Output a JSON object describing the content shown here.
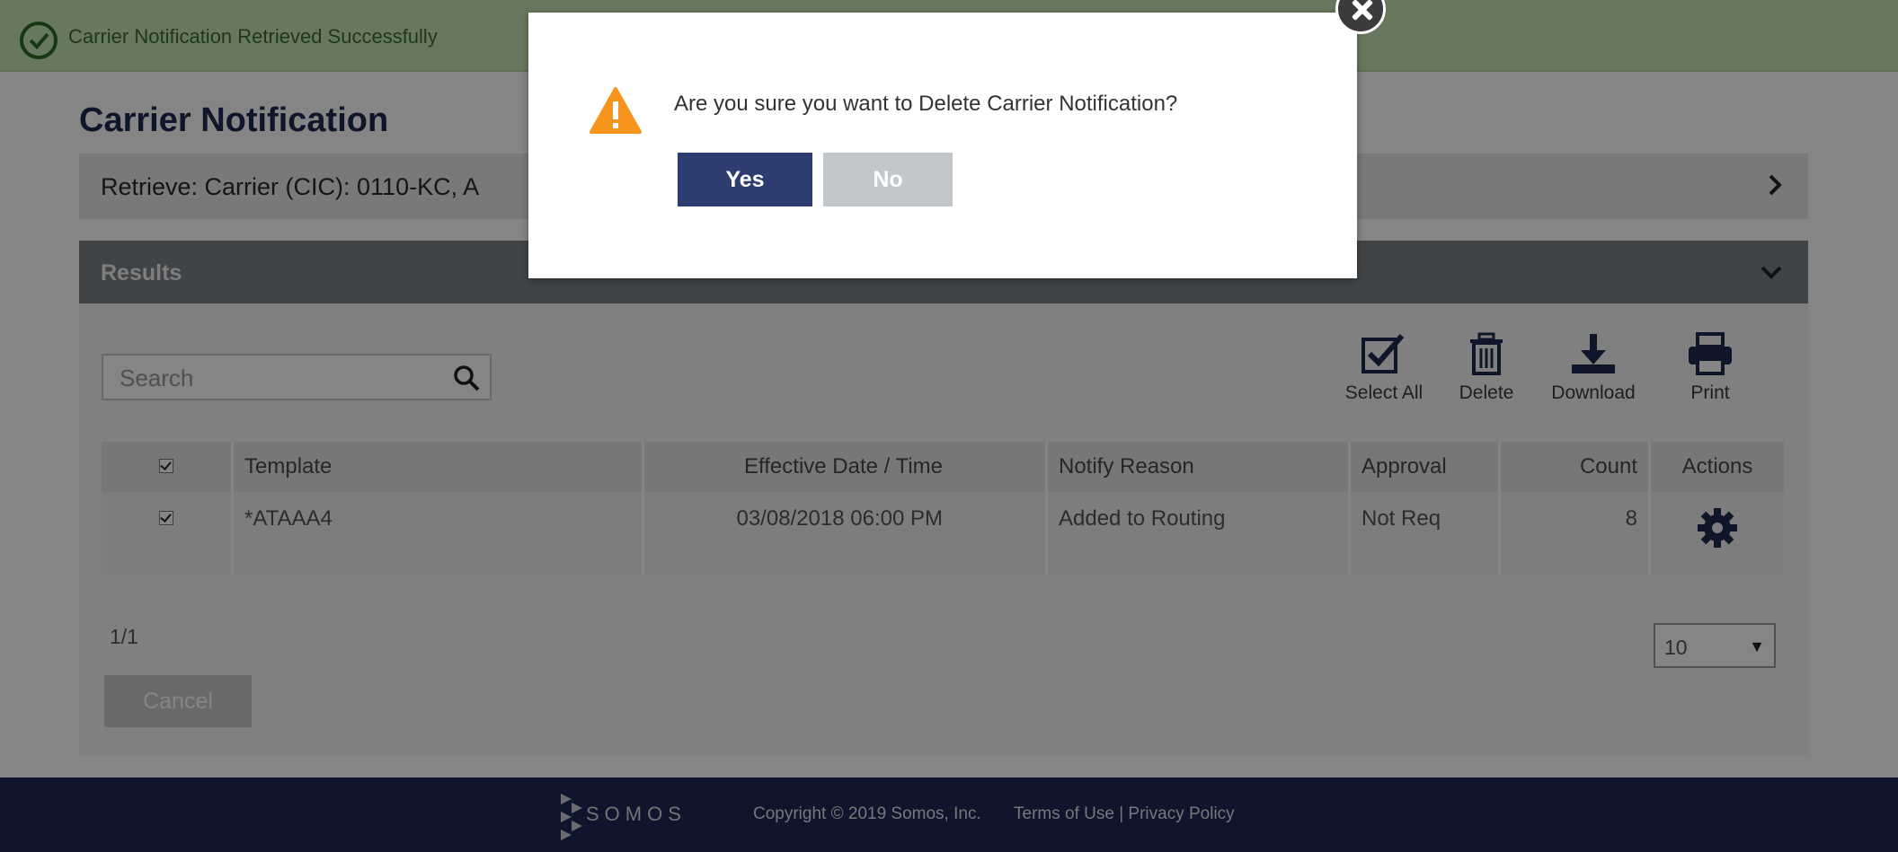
{
  "banner": {
    "message": "Carrier Notification Retrieved Successfully"
  },
  "page": {
    "title": "Carrier Notification"
  },
  "retrieve": {
    "summary": "Retrieve: Carrier (CIC): 0110-KC, A"
  },
  "results": {
    "title": "Results",
    "search_placeholder": "Search",
    "toolbar": {
      "select_all": "Select All",
      "delete": "Delete",
      "download": "Download",
      "print": "Print"
    },
    "table": {
      "columns": [
        "Template",
        "Effective Date / Time",
        "Notify Reason",
        "Approval",
        "Count",
        "Actions"
      ],
      "rows": [
        {
          "template": "*ATAAA4",
          "effective": "03/08/2018 06:00 PM",
          "reason": "Added to Routing",
          "approval": "Not Req",
          "count": "8"
        }
      ]
    },
    "pager": "1/1",
    "page_size": "10",
    "cancel_label": "Cancel"
  },
  "footer": {
    "brand": "SOMOS",
    "copyright": "Copyright © 2019 Somos, Inc.",
    "terms": "Terms of Use",
    "separator": "|",
    "privacy": "Privacy Policy"
  },
  "modal": {
    "message": "Are you sure you want to Delete Carrier Notification?",
    "yes_label": "Yes",
    "no_label": "No"
  },
  "colors": {
    "banner_bg": "#c6e6b6",
    "navy": "#1c2a55",
    "yes_button": "#2e3d6f",
    "warning": "#f7941d"
  }
}
